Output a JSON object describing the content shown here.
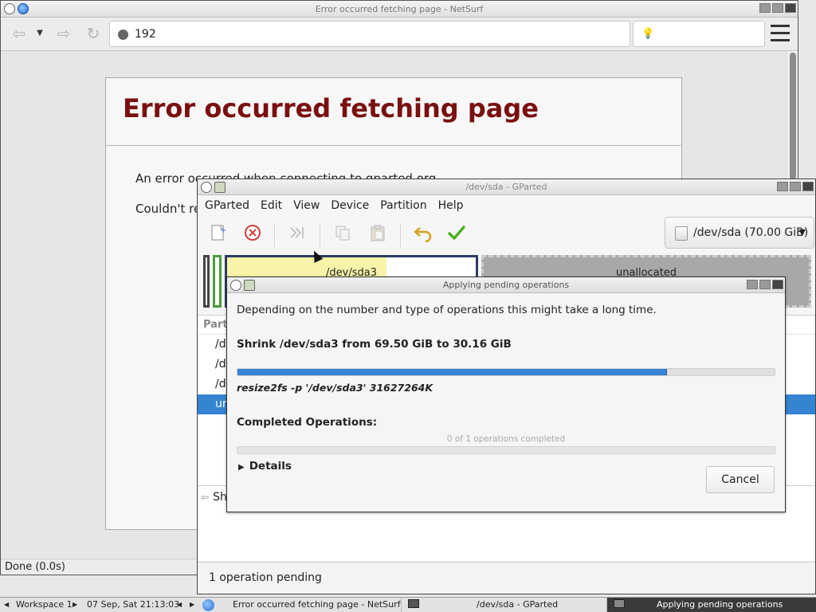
{
  "netsurf": {
    "title": "Error occurred fetching page - NetSurf",
    "url": "192",
    "error_heading": "Error occurred fetching page",
    "error_line1": "An error occurred when connecting to gparted.org",
    "error_line2": "Couldn't re",
    "status": "Done (0.0s)"
  },
  "gparted": {
    "title": "/dev/sda - GParted",
    "menu": [
      "GParted",
      "Edit",
      "View",
      "Device",
      "Partition",
      "Help"
    ],
    "device": "/dev/sda (70.00 GiB)",
    "diskmap": {
      "sda3_label": "/dev/sda3",
      "unalloc_label": "unallocated"
    },
    "list_header": "Part",
    "rows": [
      "/d",
      "/d",
      "/d",
      "ur"
    ],
    "ops_row": "Sh",
    "status": "1 operation pending"
  },
  "dialog": {
    "title": "Applying pending operations",
    "description": "Depending on the number and type of operations this might take a long time.",
    "operation": "Shrink /dev/sda3 from 69.50 GiB to 30.16 GiB",
    "progress_fraction": 0.8,
    "command": "resize2fs -p '/dev/sda3' 31627264K",
    "completed_label": "Completed Operations:",
    "completed_count": "0 of 1 operations completed",
    "details_label": "Details",
    "cancel_label": "Cancel"
  },
  "taskbar": {
    "workspace": "Workspace 1",
    "clock": "07 Sep, Sat 21:13:03",
    "apps": [
      "Error occurred fetching page - NetSurf",
      "/dev/sda - GParted",
      "Applying pending operations"
    ]
  },
  "colors": {
    "accent": "#3484d1",
    "error_heading": "#7a0f0f",
    "apply": "#4caf1f",
    "undo": "#d4a017"
  }
}
